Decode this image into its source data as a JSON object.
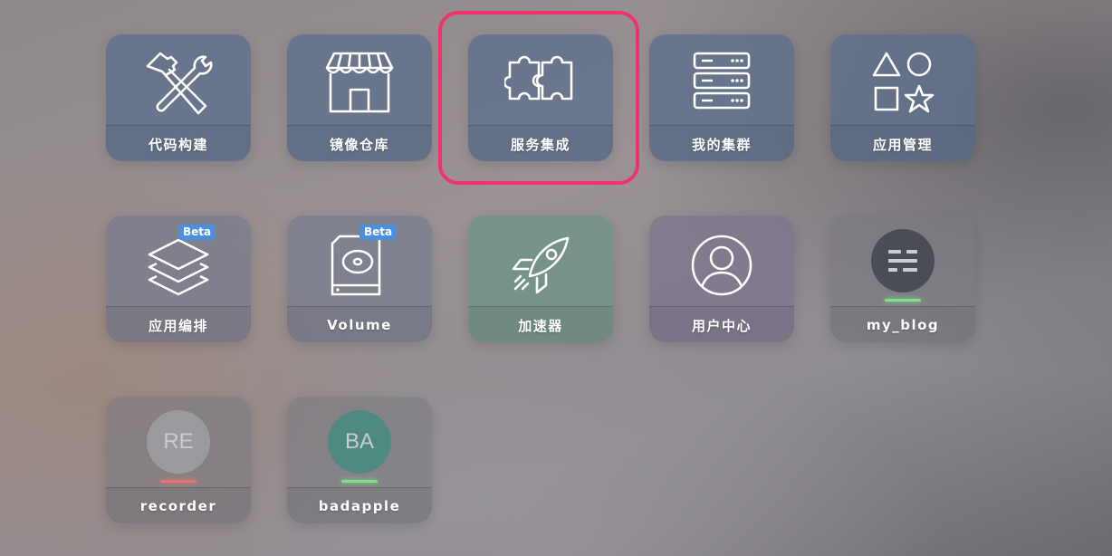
{
  "apps": {
    "code_build": {
      "label": "代码构建",
      "icon": "tools-icon"
    },
    "image_repo": {
      "label": "镜像仓库",
      "icon": "store-icon"
    },
    "service_integration": {
      "label": "服务集成",
      "icon": "puzzle-icon"
    },
    "my_cluster": {
      "label": "我的集群",
      "icon": "server-icon"
    },
    "app_management": {
      "label": "应用管理",
      "icon": "shapes-icon"
    },
    "app_orchestration": {
      "label": "应用编排",
      "icon": "layers-icon",
      "badge": "Beta"
    },
    "volume": {
      "label": "Volume",
      "icon": "disk-icon",
      "badge": "Beta"
    },
    "accelerator": {
      "label": "加速器",
      "icon": "rocket-icon"
    },
    "user_center": {
      "label": "用户中心",
      "icon": "user-icon"
    },
    "my_blog": {
      "label": "my_blog",
      "icon": "stack-icon",
      "status_color": "#7fe08a"
    },
    "recorder": {
      "label": "recorder",
      "initials": "RE",
      "avatar_color": "#9b9b9f",
      "status_color": "#e87470"
    },
    "badapple": {
      "label": "badapple",
      "initials": "BA",
      "avatar_color": "#4f8a80",
      "status_color": "#7fe08a"
    }
  },
  "highlight_color": "#f0336c"
}
